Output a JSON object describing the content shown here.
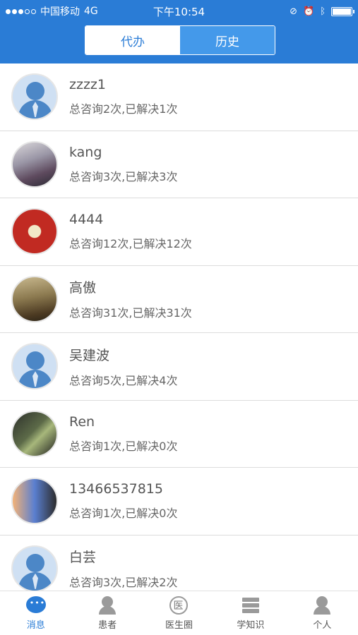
{
  "status_bar": {
    "carrier": "中国移动",
    "network": "4G",
    "time": "下午10:54"
  },
  "segmented": {
    "tabs": [
      {
        "label": "代办",
        "active": true
      },
      {
        "label": "历史",
        "active": false
      }
    ]
  },
  "conversations": [
    {
      "name": "zzzz1",
      "summary": "总咨询2次,已解决1次",
      "avatar": "default-user-icon"
    },
    {
      "name": "kang",
      "summary": "总咨询3次,已解决3次",
      "avatar": "photo"
    },
    {
      "name": "4444",
      "summary": "总咨询12次,已解决12次",
      "avatar": "photo"
    },
    {
      "name": "高傲",
      "summary": "总咨询31次,已解决31次",
      "avatar": "photo"
    },
    {
      "name": "吴建波",
      "summary": "总咨询5次,已解决4次",
      "avatar": "default-user-icon"
    },
    {
      "name": "Ren",
      "summary": "总咨询1次,已解决0次",
      "avatar": "photo"
    },
    {
      "name": "13466537815",
      "summary": "总咨询1次,已解决0次",
      "avatar": "photo"
    },
    {
      "name": "白芸",
      "summary": "总咨询3次,已解决2次",
      "avatar": "default-user-icon"
    }
  ],
  "tab_bar": {
    "items": [
      {
        "label": "消息",
        "icon": "chat-icon",
        "active": true
      },
      {
        "label": "患者",
        "icon": "patient-icon",
        "active": false
      },
      {
        "label": "医生圈",
        "icon": "doctor-circle-icon",
        "active": false
      },
      {
        "label": "学知识",
        "icon": "books-icon",
        "active": false
      },
      {
        "label": "个人",
        "icon": "person-icon",
        "active": false
      }
    ]
  },
  "colors": {
    "primary": "#2a7cd6",
    "segment_inactive": "#4499ea",
    "divider": "#dcdcdc"
  }
}
